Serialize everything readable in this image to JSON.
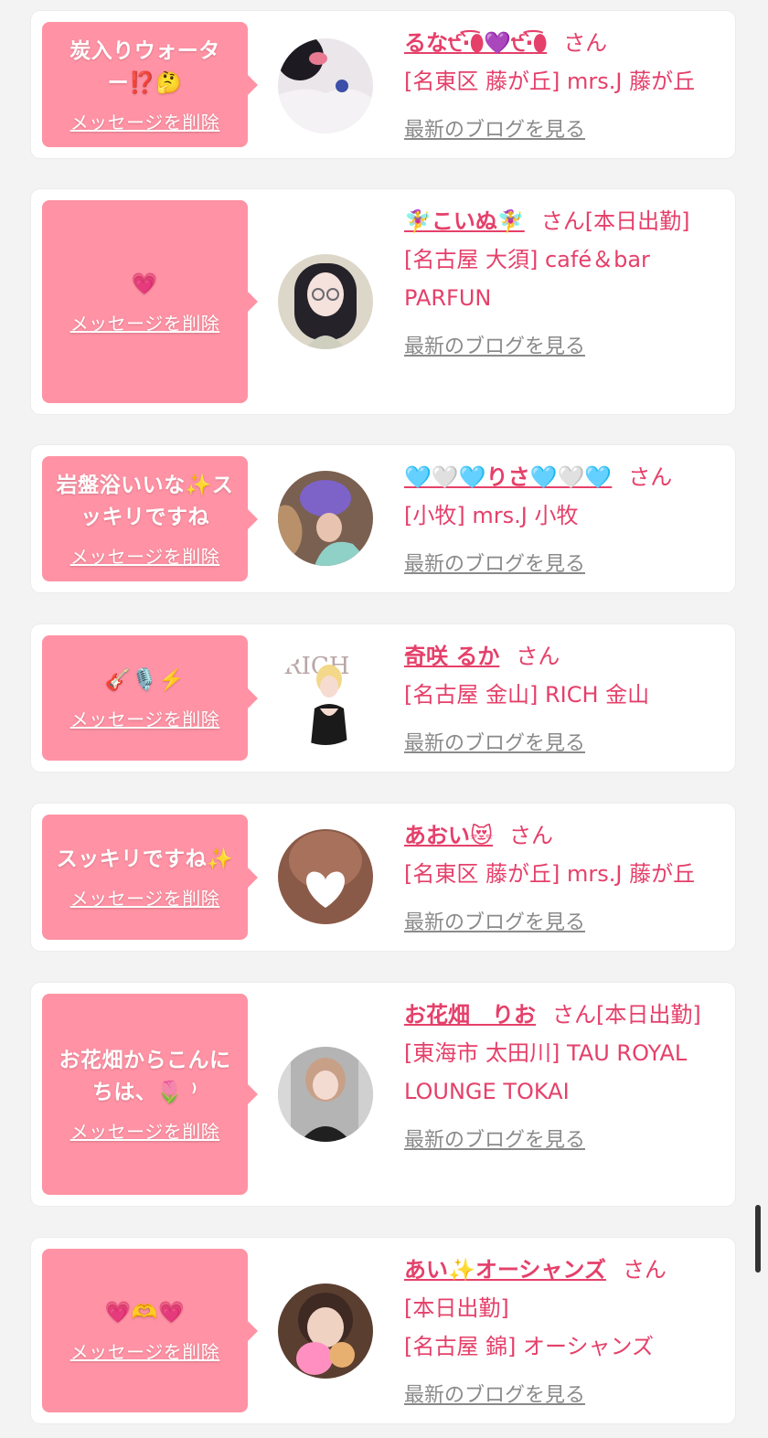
{
  "delete_label": "メッセージを削除",
  "blog_label": "最新のブログを見る",
  "honorific": "さん",
  "colors": {
    "page_bg": "#f3f3f3",
    "bubble": "#ff92a4",
    "accent": "#e5406a",
    "muted_link": "#8a8a8a"
  },
  "cards": [
    {
      "message": "炭入りウォーター⁉️🤔",
      "name": "るな੯‧̀͡⬮💜੯‧̀͡⬮",
      "tag": "",
      "shop": "[名東区 藤が丘] mrs.J 藤が丘"
    },
    {
      "message": "💗",
      "name": "🧚‍♀️こいぬ🧚‍♀️",
      "tag": "[本日出勤]",
      "shop": "[名古屋 大須] café＆bar PARFUN"
    },
    {
      "message": "岩盤浴いいな✨スッキリですね",
      "name": "🩵🤍🩵りさ🩵🤍🩵",
      "tag": "",
      "shop": "[小牧] mrs.J 小牧"
    },
    {
      "message": "🎸🎙️⚡️",
      "name": "奇咲 るか",
      "tag": "",
      "shop": "[名古屋 金山] RICH 金山"
    },
    {
      "message": "スッキリですね✨",
      "name": "あおい😻",
      "tag": "",
      "shop": "[名東区 藤が丘] mrs.J 藤が丘"
    },
    {
      "message": "お花畑からこんにちは、🌷 ⁾",
      "name": "お花畑　りお",
      "tag": "[本日出勤]",
      "shop": "[東海市 太田川] TAU ROYAL LOUNGE TOKAI"
    },
    {
      "message": "💗🫶💗",
      "name": "あい✨オーシャンズ",
      "tag": "[本日出勤]",
      "shop": "[名古屋 錦] オーシャンズ"
    }
  ]
}
